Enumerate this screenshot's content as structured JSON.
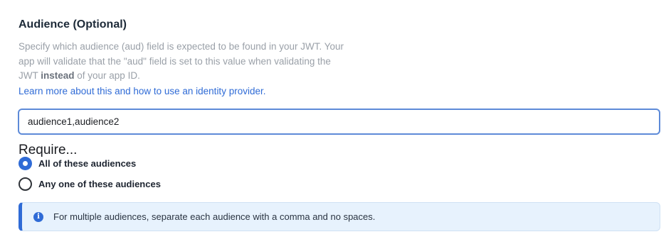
{
  "section": {
    "title": "Audience (Optional)",
    "description_part1": "Specify which audience (aud) field is expected to be found in your JWT. Your app will validate that the \"aud\" field is set to this value when validating the JWT ",
    "description_bold": "instead",
    "description_part2": " of your app ID.",
    "link_text": "Learn more about this and how to use an identity provider."
  },
  "audience_input": {
    "value": "audience1,audience2",
    "placeholder": ""
  },
  "require": {
    "title": "Require...",
    "options": [
      {
        "label": "All of these audiences",
        "selected": true
      },
      {
        "label": "Any one of these audiences",
        "selected": false
      }
    ]
  },
  "info": {
    "icon": "info-icon",
    "text": "For multiple audiences, separate each audience with a comma and no spaces."
  },
  "colors": {
    "accent": "#2f6bd6",
    "info_background": "#e7f2fd",
    "input_border": "#5d8ad8"
  }
}
